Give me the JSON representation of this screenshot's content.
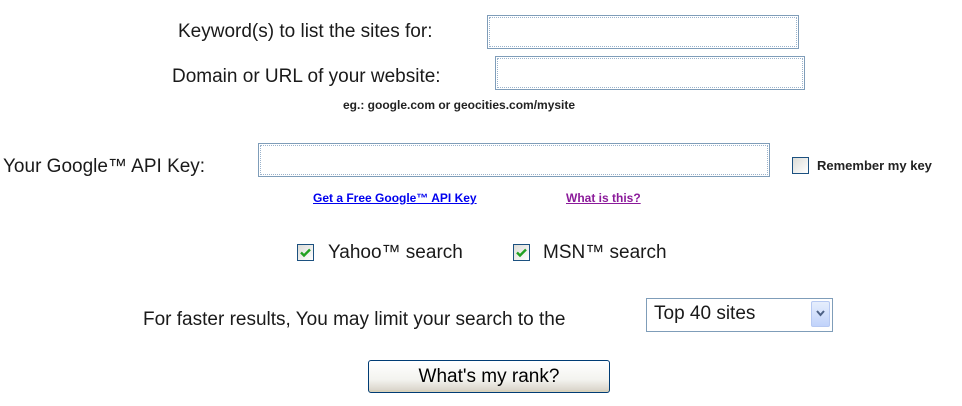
{
  "form": {
    "keyword_label": "Keyword(s) to list the sites for:",
    "keyword_value": "",
    "domain_label": "Domain or URL of your website:",
    "domain_value": "",
    "domain_hint": "eg.: google.com or geocities.com/mysite",
    "api_key_label": "Your Google™ API Key:",
    "api_key_value": "",
    "remember_label": "Remember my key",
    "remember_checked": false,
    "links": {
      "get_key": "Get a Free Google™ API Key",
      "what_is_this": "What is this?"
    },
    "engines": {
      "yahoo_label": "Yahoo™ search",
      "yahoo_checked": true,
      "msn_label": "MSN™ search",
      "msn_checked": true
    },
    "limit_label": "For faster results, You may limit your search to the",
    "limit_selected": "Top 40 sites",
    "submit_label": "What's my rank?"
  },
  "colors": {
    "link_blue": "#0000ee",
    "link_visited": "#8b1a9a",
    "checkmark_green": "#21a121",
    "input_border": "#7f9db9"
  },
  "icons": {
    "checkbox_check": "checkmark-icon",
    "select_arrow": "chevron-down-icon"
  }
}
